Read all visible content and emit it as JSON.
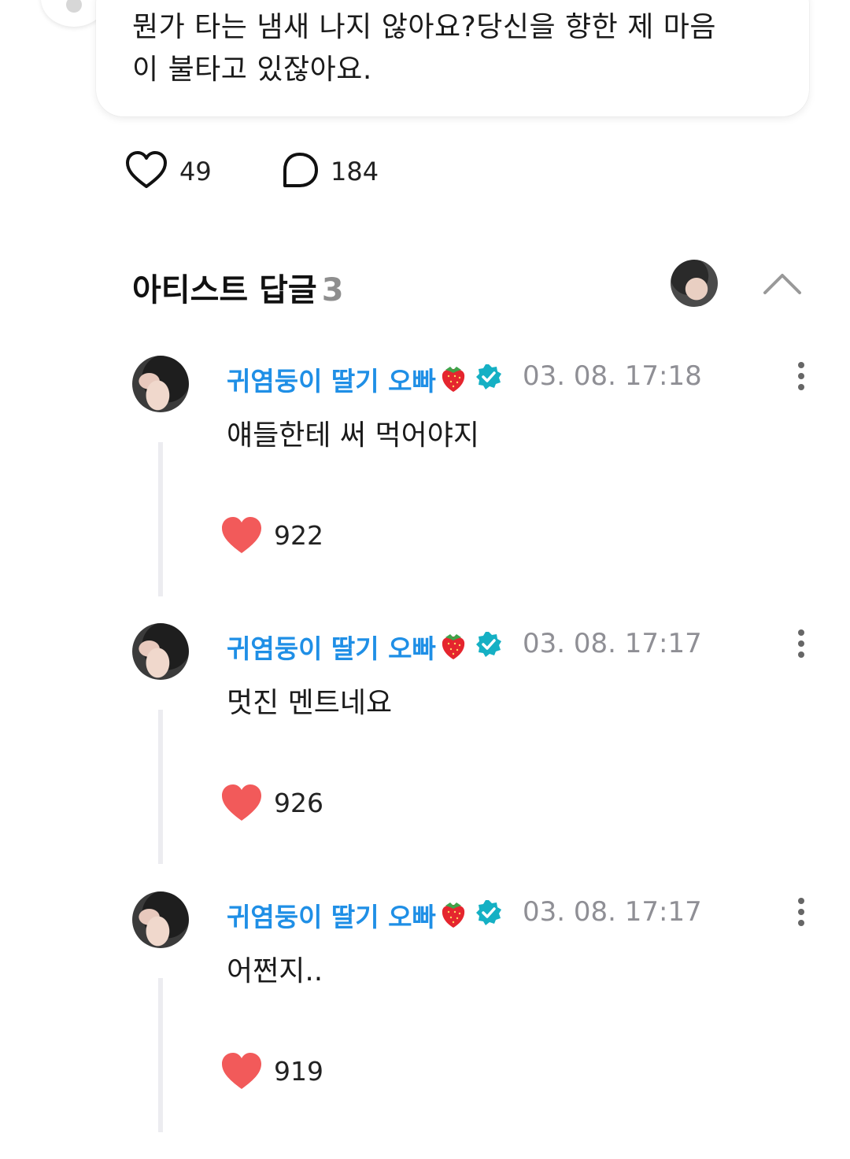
{
  "post": {
    "line1": "뭔가 타는 냄새 나지 않아요?당신을 향한 제 마음",
    "line2": "이 불타고 있잖아요."
  },
  "post_actions": {
    "likes": "49",
    "comments": "184"
  },
  "artist_replies": {
    "title": "아티스트 답글",
    "count": "3",
    "replies": [
      {
        "name": "귀염둥이 딸기 오빠",
        "time": "03. 08. 17:18",
        "text": "얘들한테 써 먹어야지",
        "likes": "922"
      },
      {
        "name": "귀염둥이 딸기 오빠",
        "time": "03. 08. 17:17",
        "text": "멋진 멘트네요",
        "likes": "926"
      },
      {
        "name": "귀염둥이 딸기 오빠",
        "time": "03. 08. 17:17",
        "text": "어쩐지..",
        "likes": "919"
      }
    ]
  },
  "colors": {
    "accent_name": "#1f8fe6",
    "verified_badge": "#15b0c4",
    "like_heart": "#f25a5a",
    "timestamp": "#8f8f95"
  },
  "icons": {
    "like": "heart-outline-icon",
    "comment": "speech-bubble-icon",
    "collapse": "chevron-up-icon",
    "more": "more-vertical-icon",
    "verified": "verified-badge-icon",
    "emoji": "strawberry-emoji-icon",
    "liked": "heart-filled-icon"
  }
}
